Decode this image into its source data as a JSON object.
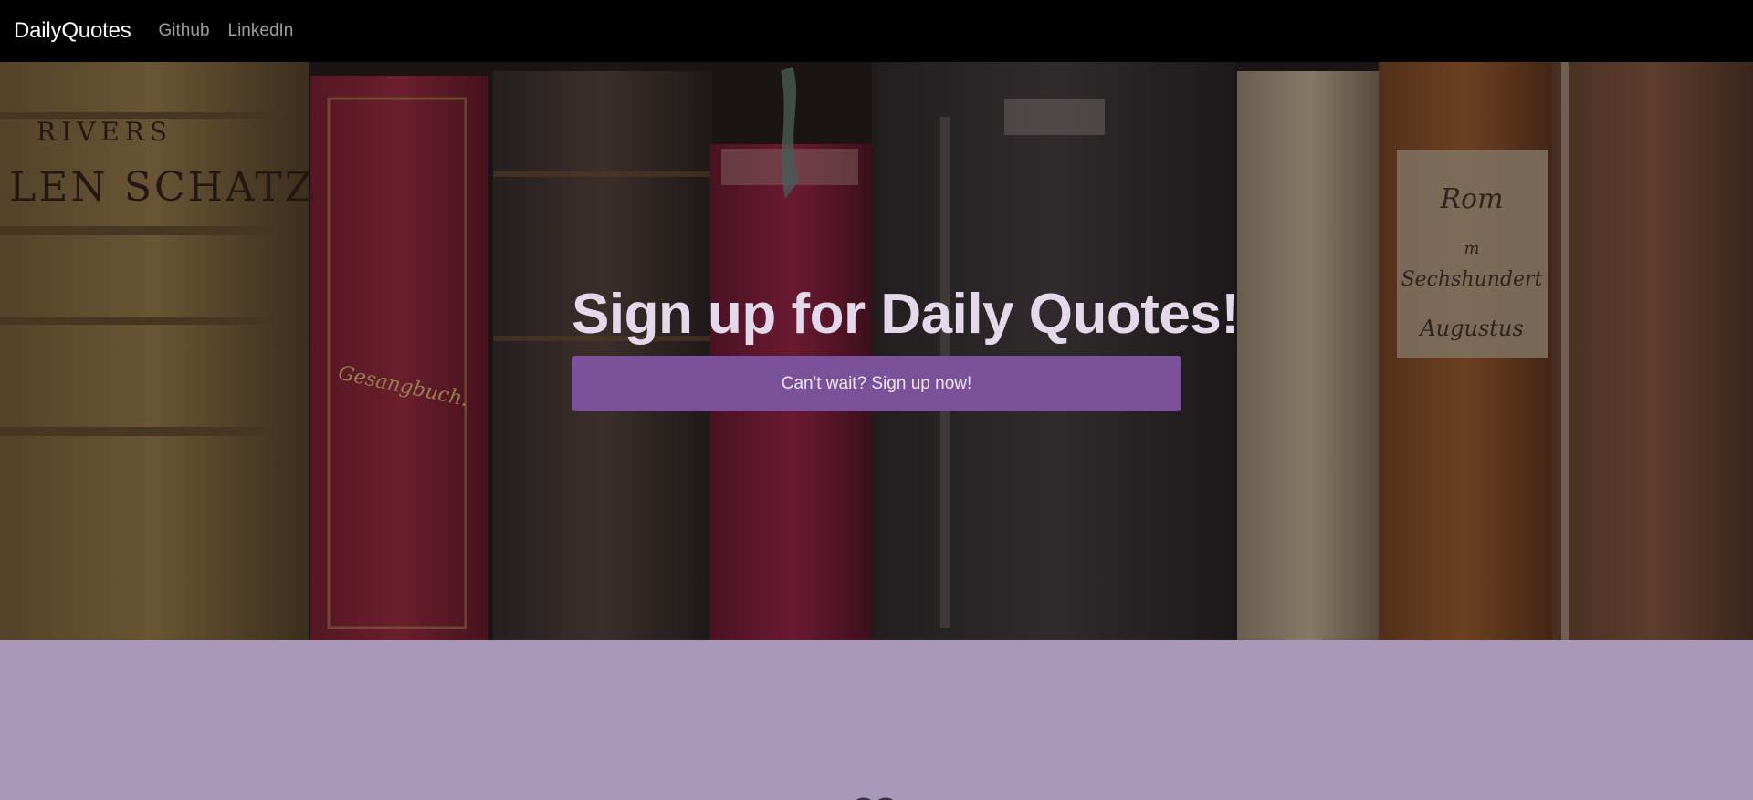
{
  "navbar": {
    "brand": "DailyQuotes",
    "links": [
      {
        "label": "Github"
      },
      {
        "label": "LinkedIn"
      }
    ]
  },
  "hero": {
    "title": "Sign up for Daily Quotes!",
    "cta_label": "Can't wait? Sign up now!",
    "background": "bookshelf-image"
  },
  "features": {
    "icons": [
      "heart-icon",
      "users-icon",
      "circle-icon"
    ]
  },
  "colors": {
    "navbar_bg": "#000000",
    "accent": "#7b5299",
    "features_bg": "#a899bb",
    "title_text": "#e4d9ea"
  }
}
